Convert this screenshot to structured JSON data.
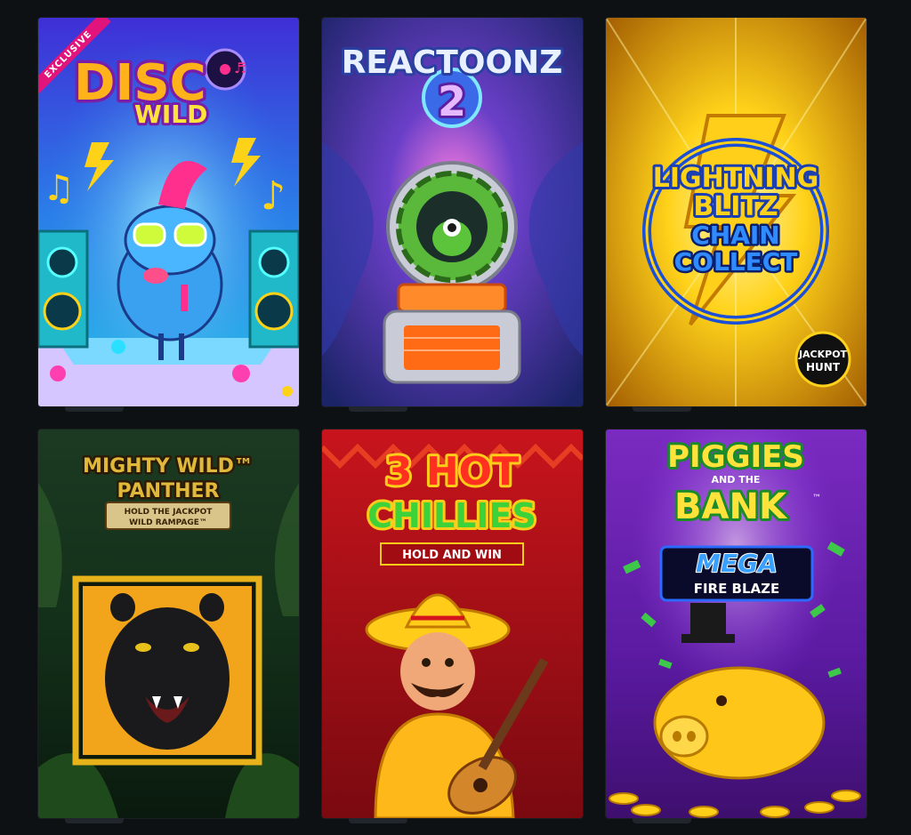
{
  "colors": {
    "page_bg": "#0d1114",
    "tile_tab": "#20262b"
  },
  "tiles": [
    {
      "name": "disco-wild",
      "badge": "EXCLUSIVE",
      "title_line1": "DISC",
      "title_line2": "WILD",
      "glyphs": [
        "♫",
        "♪",
        "♬"
      ],
      "colors": {
        "bg_top": "#3f2fd6",
        "bg_bottom": "#22c7e8",
        "accent": "#ff2f8e",
        "title": "#ffb21a"
      }
    },
    {
      "name": "reactoonz-2",
      "title_line1": "REACTOONZ",
      "title_line2": "2",
      "colors": {
        "bg_top": "#2a2f8e",
        "bg_bottom": "#5a2f9e",
        "accent": "#ff6a14",
        "title": "#e9f0ff"
      }
    },
    {
      "name": "lightning-blitz-chain-collect",
      "title_line1": "LIGHTNING",
      "title_line2": "BLITZ",
      "title_line3": "CHAIN",
      "title_line4": "COLLECT",
      "corner_badge_line1": "JACKPOT",
      "corner_badge_line2": "HUNT",
      "colors": {
        "bg_top": "#a85a00",
        "bg_bottom": "#ffe04a",
        "accent": "#1b4fd8",
        "title": "#ffd21a"
      }
    },
    {
      "name": "mighty-wild-panther",
      "title_line1": "MIGHTY WILD™",
      "title_line2": "PANTHER",
      "subtitle_line1": "HOLD THE JACKPOT",
      "subtitle_line2": "WILD RAMPAGE™",
      "colors": {
        "bg_top": "#16321c",
        "bg_bottom": "#0a1a0e",
        "accent": "#e8b21a",
        "title": "#e0b83a"
      }
    },
    {
      "name": "3-hot-chillies",
      "title_line1": "3 HOT",
      "title_line2": "CHILLIES",
      "subtitle": "HOLD AND WIN",
      "colors": {
        "bg_top": "#b8141c",
        "bg_bottom": "#8a0c12",
        "accent": "#ffcc1a",
        "title": "#ff3020",
        "title2": "#3ed23a"
      }
    },
    {
      "name": "piggies-and-the-bank-mega-fire-blaze",
      "title_line1": "PIGGIES",
      "title_small": "AND THE",
      "title_line2": "BANK",
      "title_tm": "™",
      "title_line3": "MEGA",
      "title_line4": "FIRE BLAZE",
      "colors": {
        "bg_top": "#6a1fa8",
        "bg_bottom": "#3e0f6e",
        "accent": "#ffc61a",
        "title": "#ffe23a"
      }
    }
  ]
}
